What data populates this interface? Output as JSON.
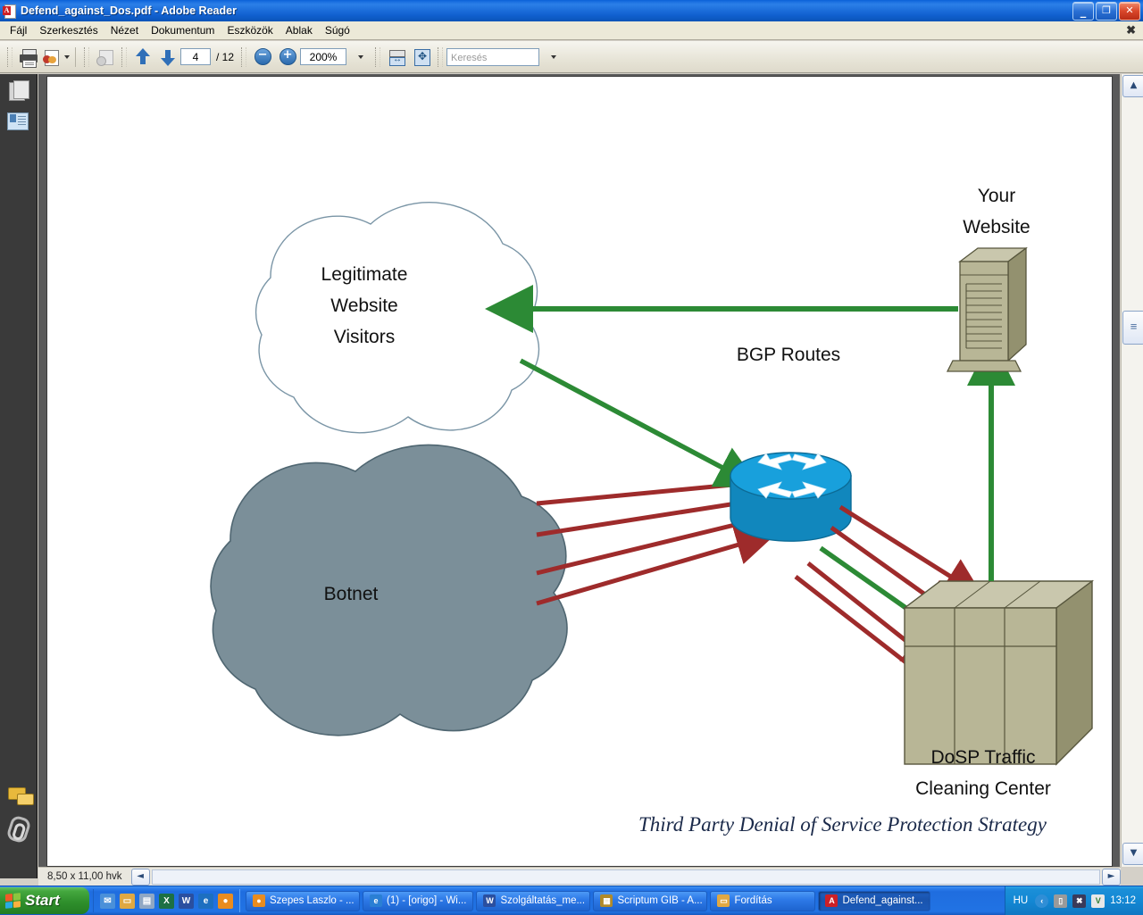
{
  "window": {
    "title": "Defend_against_Dos.pdf - Adobe Reader",
    "app_icon": "pdf-icon",
    "minimize": "_",
    "restore": "❐",
    "close": "✕",
    "doc_close": "✖"
  },
  "menu": {
    "items": [
      {
        "label": "Fájl"
      },
      {
        "label": "Szerkesztés"
      },
      {
        "label": "Nézet"
      },
      {
        "label": "Dokumentum"
      },
      {
        "label": "Eszközök"
      },
      {
        "label": "Ablak"
      },
      {
        "label": "Súgó"
      }
    ]
  },
  "toolbar": {
    "print_icon": "printer-icon",
    "email_icon": "attach-to-email-icon",
    "snapshot_icon": "snapshot-icon",
    "prev_icon": "previous-page-icon",
    "next_icon": "next-page-icon",
    "page_current": "4",
    "page_separator": "/ 12",
    "zoom_out_icon": "−",
    "zoom_in_icon": "+",
    "zoom_value": "200%",
    "fit_width_icon": "fit-width-icon",
    "fit_page_icon": "fit-page-icon",
    "search_placeholder": "Keresés"
  },
  "navpane": {
    "pages_icon": "pages-thumbnail-icon",
    "bookmarks_icon": "bookmarks-icon",
    "comments_icon": "comments-icon",
    "attachments_icon": "attachments-paperclip-icon"
  },
  "diagram": {
    "title_caption": "Third Party Denial of Service Protection Strategy",
    "nodes": [
      {
        "id": "visitors-cloud",
        "label_lines": [
          "Legitimate",
          "Website",
          "Visitors"
        ],
        "shape": "cloud",
        "fill": "#ffffff",
        "stroke": "#7a95a6"
      },
      {
        "id": "botnet-cloud",
        "label_lines": [
          "Botnet"
        ],
        "shape": "cloud",
        "fill": "#7b8f99",
        "stroke": "#4f6671"
      },
      {
        "id": "bgp-router",
        "label_lines": [
          "BGP Routes"
        ],
        "shape": "router",
        "fill": "#18a0dc",
        "stroke": "#0f7dae"
      },
      {
        "id": "your-website",
        "label_lines": [
          "Your",
          "Website"
        ],
        "shape": "server-tower",
        "fill": "#b6b491",
        "stroke": "#6e6d51"
      },
      {
        "id": "cleaning-center",
        "label_lines": [
          "DoSP Traffic",
          "Cleaning Center"
        ],
        "shape": "server-rack",
        "fill": "#b8b696",
        "stroke": "#6e6d51"
      }
    ],
    "colors": {
      "clean_traffic": "#2c8a35",
      "attack_traffic": "#9e2b2b",
      "router_body": "#18a0dc",
      "router_side": "#1187bd",
      "server_face": "#b8b696",
      "server_top": "#c9c7ad",
      "server_side": "#93916f",
      "botnet_fill": "#7b8f99"
    },
    "flows": [
      {
        "from": "botnet-cloud",
        "to": "bgp-router",
        "type": "attack",
        "count": 4
      },
      {
        "from": "visitors-cloud",
        "to": "bgp-router",
        "type": "clean",
        "count": 1
      },
      {
        "from": "bgp-router",
        "to": "cleaning-center",
        "type": "attack",
        "count": 4
      },
      {
        "from": "bgp-router",
        "to": "cleaning-center",
        "type": "clean",
        "count": 1
      },
      {
        "from": "cleaning-center",
        "to": "your-website",
        "type": "clean",
        "count": 1
      },
      {
        "from": "your-website",
        "to": "visitors-cloud",
        "type": "clean",
        "count": 1
      }
    ]
  },
  "statusbar": {
    "page_size": "8,50 x 11,00 hvk"
  },
  "scrollbar": {
    "up_icon": "▲",
    "down_icon": "▼",
    "left_icon": "◄",
    "right_icon": "►",
    "thumb_icon": "≡"
  },
  "taskbar": {
    "start_label": "Start",
    "quick_launch": [
      {
        "name": "quicklaunch-messenger",
        "glyph": "✉",
        "color": "#4a90d9"
      },
      {
        "name": "quicklaunch-folder",
        "glyph": "📁",
        "color": "#e0a843"
      },
      {
        "name": "quicklaunch-media",
        "glyph": "▤",
        "color": "#8fa7c4"
      },
      {
        "name": "quicklaunch-excel",
        "glyph": "X",
        "color": "#1d7044"
      },
      {
        "name": "quicklaunch-word",
        "glyph": "W",
        "color": "#2a4fa0"
      },
      {
        "name": "quicklaunch-ie",
        "glyph": "e",
        "color": "#1d6fc0"
      },
      {
        "name": "quicklaunch-firefox",
        "glyph": "●",
        "color": "#e98c1f"
      }
    ],
    "tasks": [
      {
        "label": "Szepes Laszlo - ...",
        "glyph": "●",
        "color": "#e98c1f",
        "active": false
      },
      {
        "label": "(1) - [origo] - Wi...",
        "glyph": "e",
        "color": "#2a7fd4",
        "active": false
      },
      {
        "label": "Szolgáltatás_me...",
        "glyph": "W",
        "color": "#2a4fa0",
        "active": false
      },
      {
        "label": "Scriptum GIB - A...",
        "glyph": "▦",
        "color": "#b08a2a",
        "active": false
      },
      {
        "label": "Fordítás",
        "glyph": "📁",
        "color": "#e0a843",
        "active": false
      },
      {
        "label": "Defend_against...",
        "glyph": "A",
        "color": "#cc2027",
        "active": true
      }
    ],
    "tray": {
      "language": "HU",
      "icons": [
        {
          "name": "show-hidden-icons",
          "glyph": "‹",
          "color": "#2f8ed6"
        },
        {
          "name": "security-lock-icon",
          "glyph": "🔒",
          "color": "#9a9a9a"
        },
        {
          "name": "network-error-icon",
          "glyph": "✖",
          "color": "#c0392b"
        },
        {
          "name": "antivirus-icon",
          "glyph": "V",
          "color": "#2e7d32"
        }
      ],
      "clock": "13:12"
    }
  }
}
